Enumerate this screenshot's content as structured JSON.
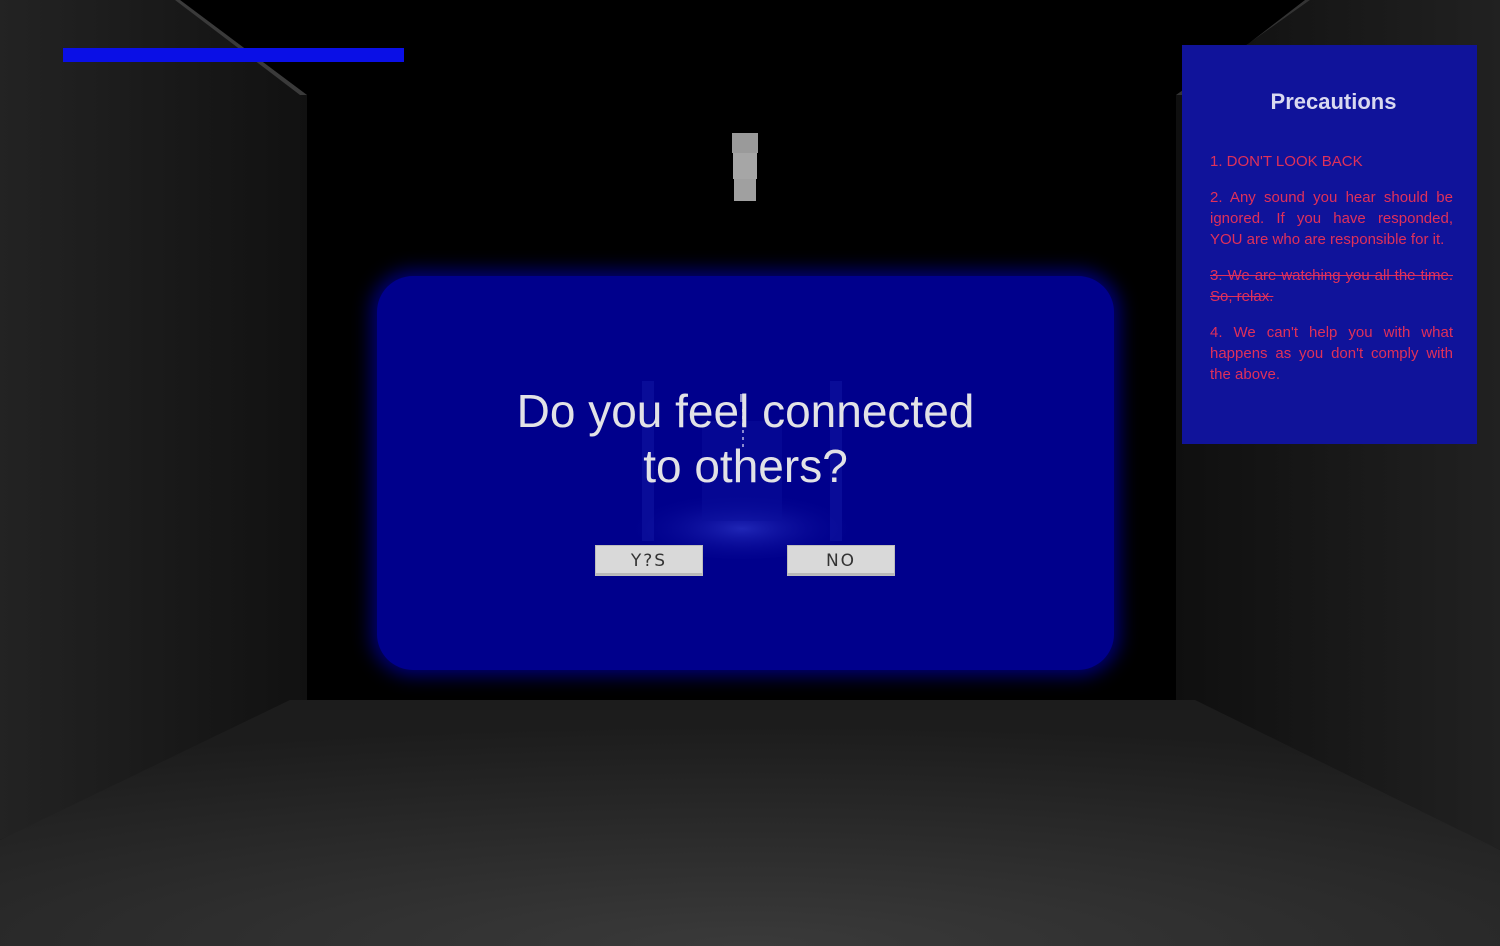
{
  "game": {
    "progress": 0.5,
    "accent_color": "#0a0fe6",
    "rule_text_color": "#e0305a"
  },
  "dialog": {
    "question_line1": "Do you feel connected",
    "question_line2": "to others?",
    "yes_label": "Y?S",
    "no_label": "NO"
  },
  "precautions": {
    "title": "Precautions",
    "rules": [
      {
        "text": "1. DON'T LOOK BACK",
        "struck": false
      },
      {
        "text": "2. Any sound you hear should be ignored. If you have responded, YOU are who are responsible for it.",
        "struck": false
      },
      {
        "text": "3. We are watching you all the time. So, relax.",
        "struck": true
      },
      {
        "text": "4. We can't help you with what happens as you don't comply with the above.",
        "struck": false
      }
    ]
  }
}
